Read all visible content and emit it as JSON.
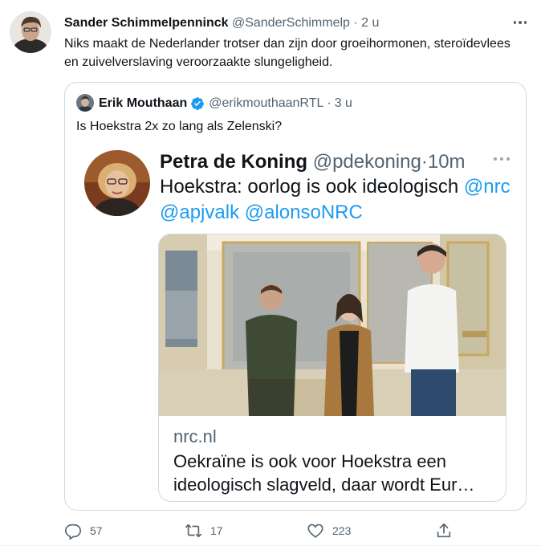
{
  "tweet": {
    "author_name": "Sander Schimmelpenninck",
    "author_handle": "@SanderSchimmelp",
    "separator": "·",
    "time": "2 u",
    "text": "Niks maakt de Nederlander trotser dan zijn door groeihormonen, steroïdevlees en zuivelverslaving veroorzaakte slungeligheid.",
    "more_icon": "more-horizontal-icon"
  },
  "quote": {
    "author_name": "Erik Mouthaan",
    "verified_icon": "verified-badge-icon",
    "author_handle": "@erikmouthaanRTL",
    "separator": "·",
    "time": "3 u",
    "text": "Is Hoekstra 2x zo lang als Zelenski?"
  },
  "embedded": {
    "author_name": "Petra de Koning",
    "author_handle": "@pdekoning",
    "separator": "·",
    "time": "10m",
    "text_plain": "Hoekstra: oorlog is ook ideologisch",
    "mention_1": "@nrc",
    "mention_2": "@apjvalk",
    "mention_3": "@alonsoNRC",
    "card": {
      "domain": "nrc.nl",
      "title": "Oekraïne is ook voor Hoekstra een ideologisch slagveld, daar wordt Eur…"
    }
  },
  "actions": {
    "replies": "57",
    "retweets": "17",
    "likes": "223"
  },
  "colors": {
    "text": "#0f1419",
    "muted": "#536471",
    "link": "#1d9bf0",
    "border": "#cfd9de"
  }
}
